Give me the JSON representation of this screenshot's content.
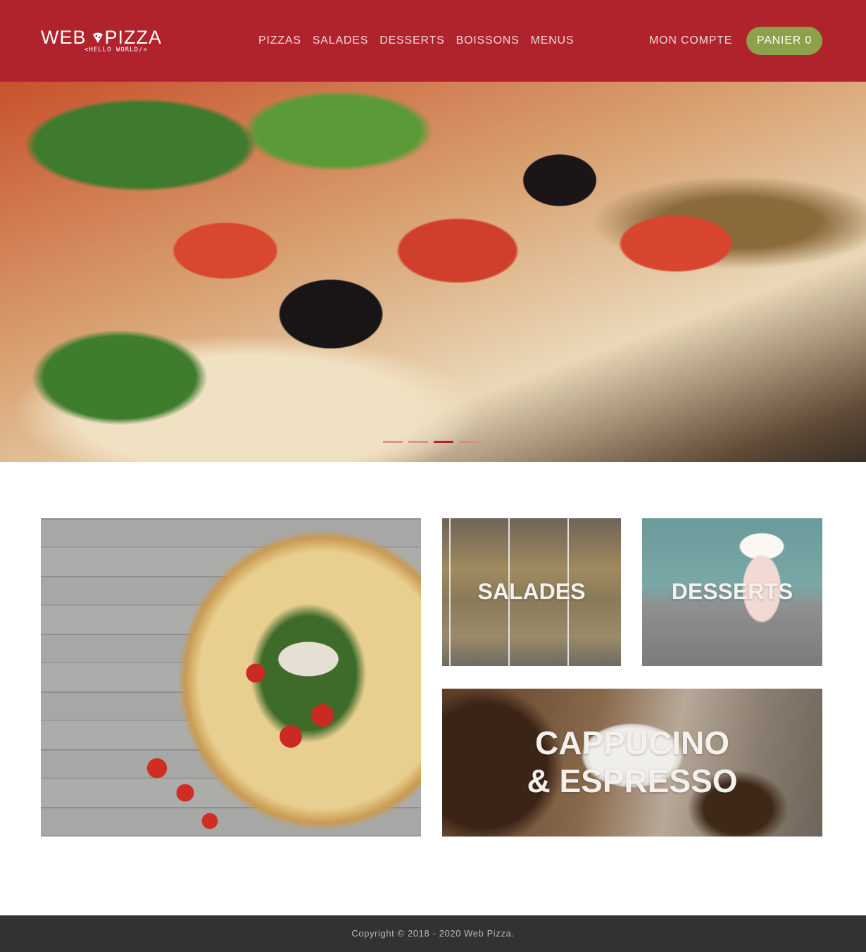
{
  "brand": {
    "name_left": "WEB",
    "name_right": "PIZZA",
    "tagline": "<HELLO WORLD/>",
    "color": "#b0222c"
  },
  "nav": {
    "items": [
      {
        "label": "PIZZAS"
      },
      {
        "label": "SALADES"
      },
      {
        "label": "DESSERTS"
      },
      {
        "label": "BOISSONS"
      },
      {
        "label": "MENUS"
      }
    ],
    "account_label": "MON COMPTE",
    "cart_label": "PANIER",
    "cart_count": "0",
    "cart_color": "#8fa04a"
  },
  "hero": {
    "slides_count": 4,
    "active_slide": 3
  },
  "tiles": {
    "salades": "SALADES",
    "desserts": "DESSERTS",
    "coffee_line1": "CAPPUCINO",
    "coffee_line2": "& ESPRESSO"
  },
  "footer": {
    "copyright": "Copyright © 2018 - 2020 Web Pizza."
  }
}
